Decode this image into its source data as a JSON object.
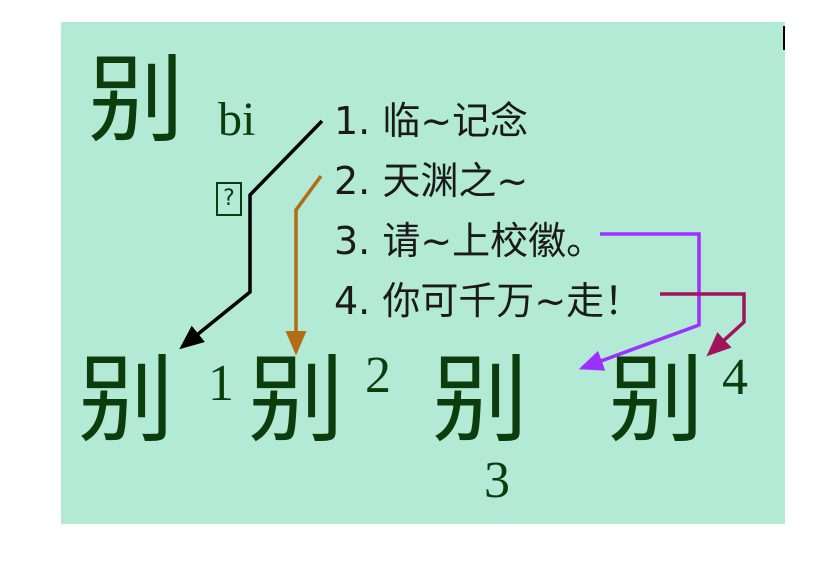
{
  "header": {
    "char": "别",
    "pinyin": "bi",
    "box": "?"
  },
  "meanings": [
    {
      "label": "1. 临~记念"
    },
    {
      "label": "2. 天渊之~"
    },
    {
      "label": "3. 请~上校徽。"
    },
    {
      "label": "4. 你可千万~走！"
    }
  ],
  "chars": [
    {
      "char": "别",
      "index": "1"
    },
    {
      "char": "别",
      "index": "2"
    },
    {
      "char": "别",
      "index": "3"
    },
    {
      "char": "别",
      "index": "4"
    }
  ],
  "arrow_colors": [
    "#000000",
    "#b36b14",
    "#9b30ff",
    "#a0145a"
  ]
}
